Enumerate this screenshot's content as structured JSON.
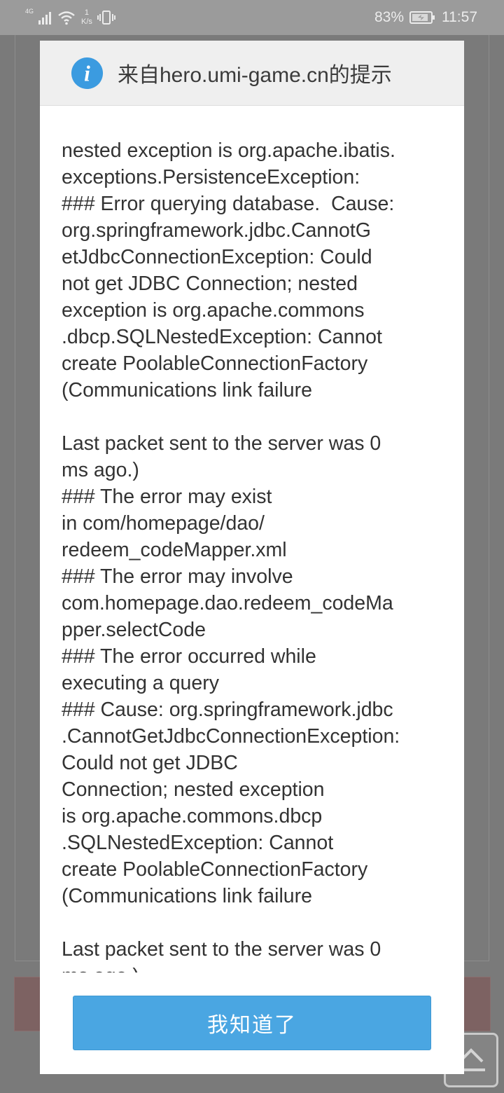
{
  "status_bar": {
    "network": "4G",
    "speed_value": "1",
    "speed_unit": "K/s",
    "battery_percent": "83%",
    "time": "11:57"
  },
  "dialog": {
    "title": "来自hero.umi-game.cn的提示",
    "icon": "info-icon",
    "message_lines": [
      "nested exception is org.apache.ibatis.",
      "exceptions.PersistenceException:",
      "### Error querying database.  Cause:",
      "org.springframework.jdbc.CannotG",
      "etJdbcConnectionException: Could",
      "not get JDBC Connection; nested",
      "exception is org.apache.commons",
      ".dbcp.SQLNestedException: Cannot",
      "create PoolableConnectionFactory",
      "(Communications link failure",
      "",
      "Last packet sent to the server was 0",
      "ms ago.)",
      "### The error may exist",
      "in com/homepage/dao/",
      "redeem_codeMapper.xml",
      "### The error may involve",
      "com.homepage.dao.redeem_codeMa",
      "pper.selectCode",
      "### The error occurred while",
      "executing a query",
      "### Cause: org.springframework.jdbc",
      ".CannotGetJdbcConnectionException:",
      "Could not get JDBC",
      "Connection; nested exception",
      "is org.apache.commons.dbcp",
      ".SQLNestedException: Cannot",
      "create PoolableConnectionFactory",
      "(Communications link failure",
      "",
      "Last packet sent to the server was 0",
      "ms ago.)"
    ],
    "ok_label": "我知道了"
  },
  "colors": {
    "overlay": "#7a7a7a",
    "status_bar": "#9b9b9b",
    "header_bg": "#efefef",
    "info_icon": "#3b9be0",
    "button": "#4aa6e2"
  }
}
